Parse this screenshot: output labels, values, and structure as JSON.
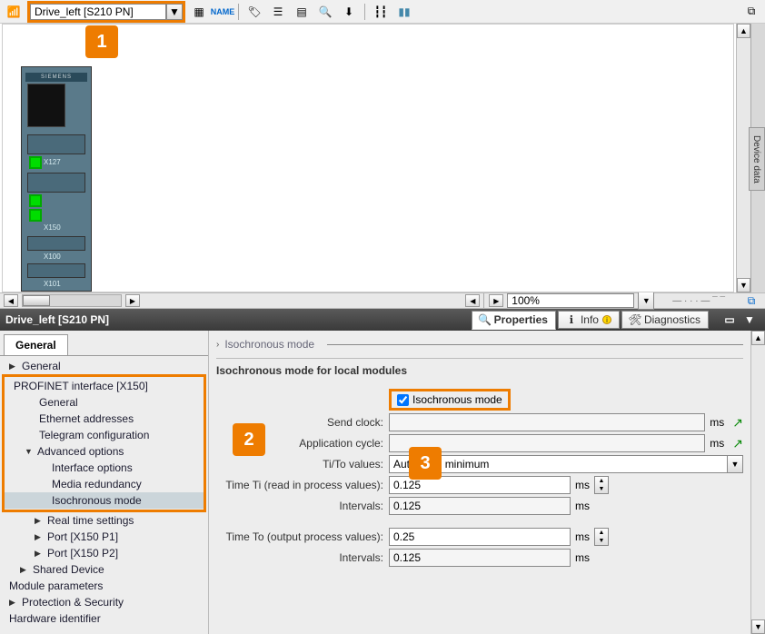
{
  "toolbar": {
    "device_dropdown": "Drive_left [S210 PN]"
  },
  "device": {
    "brand": "SIEMENS",
    "ports": {
      "x127": "X127",
      "x150": "X150",
      "x100": "X100",
      "x101": "X101"
    }
  },
  "zoom": "100%",
  "side_tab": "Device data",
  "titlebar": {
    "title": "Drive_left [S210 PN]",
    "tabs": {
      "properties": "Properties",
      "info": "Info",
      "diagnostics": "Diagnostics"
    }
  },
  "tree": {
    "tab": "General",
    "items": {
      "general": "General",
      "pn_interface": "PROFINET interface [X150]",
      "pn_general": "General",
      "ethernet": "Ethernet addresses",
      "telegram": "Telegram configuration",
      "adv_options": "Advanced options",
      "iface_options": "Interface options",
      "media_red": "Media redundancy",
      "iso_mode": "Isochronous mode",
      "realtime": "Real time settings",
      "port1": "Port [X150 P1]",
      "port2": "Port [X150 P2]",
      "shared": "Shared Device",
      "module_params": "Module parameters",
      "protection": "Protection & Security",
      "hw_id": "Hardware identifier"
    }
  },
  "form": {
    "crumb": "Isochronous mode",
    "section": "Isochronous mode for local modules",
    "check_label": "Isochronous mode",
    "labels": {
      "send_clock": "Send clock:",
      "app_cycle": "Application cycle:",
      "tito": "Ti/To values:",
      "time_ti": "Time Ti (read in process values):",
      "intervals1": "Intervals:",
      "time_to": "Time To (output process values):",
      "intervals2": "Intervals:"
    },
    "values": {
      "send_clock": "",
      "app_cycle": "",
      "tito": "Automatic minimum",
      "time_ti": "0.125",
      "intervals1": "0.125",
      "time_to": "0.25",
      "intervals2": "0.125"
    },
    "unit": "ms"
  },
  "callouts": {
    "c1": "1",
    "c2": "2",
    "c3": "3"
  }
}
